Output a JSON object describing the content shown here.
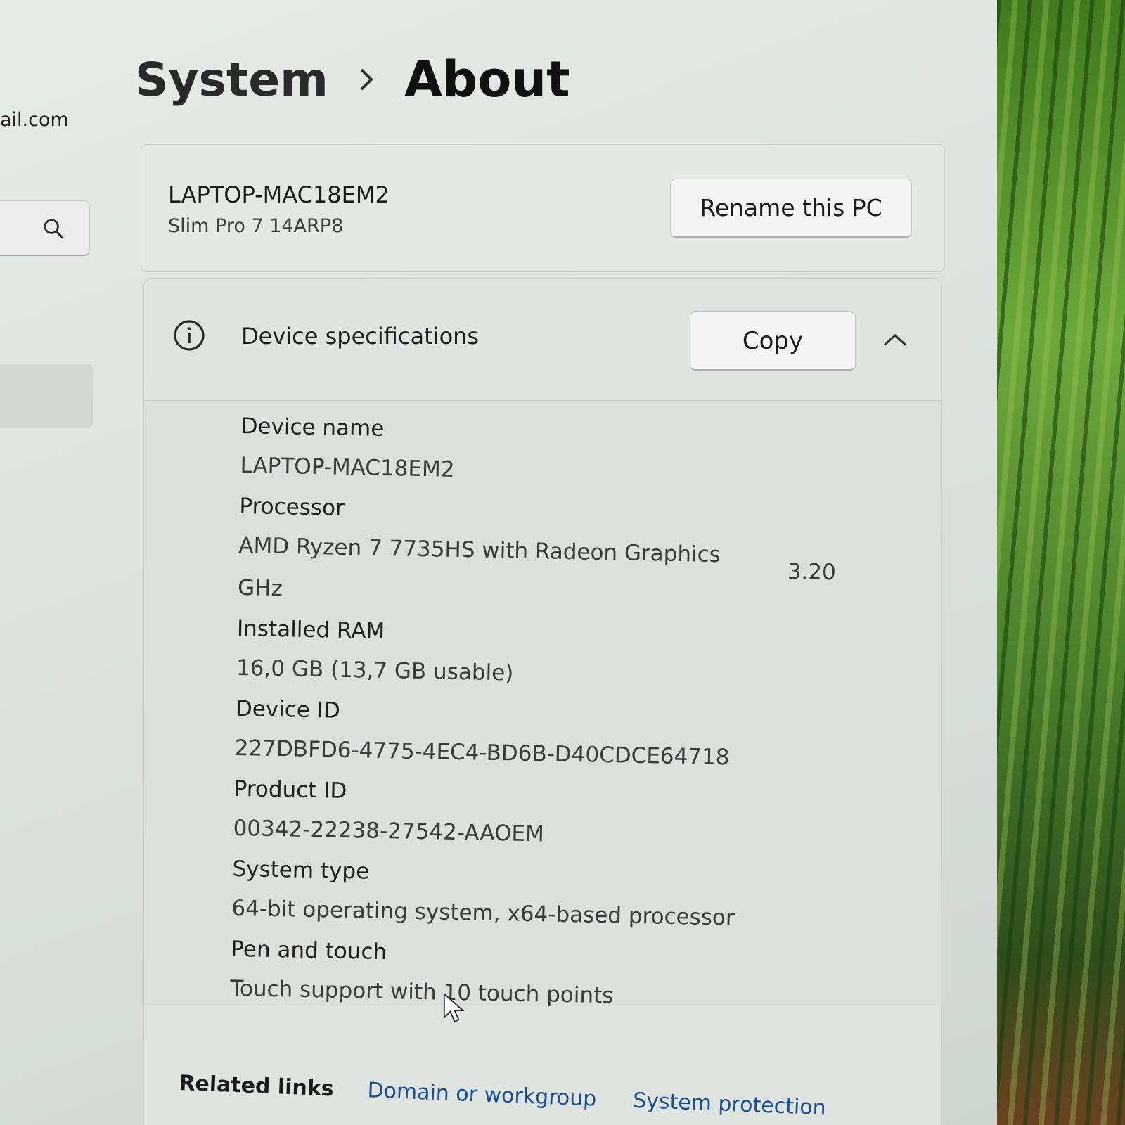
{
  "sidebar": {
    "account_email": "ail.com",
    "search_icon": "search-icon"
  },
  "breadcrumb": {
    "parent": "System",
    "current": "About"
  },
  "pc": {
    "name": "LAPTOP-MAC18EM2",
    "model": "Slim Pro 7 14ARP8",
    "rename_label": "Rename this PC"
  },
  "device_specs": {
    "title": "Device specifications",
    "copy_label": "Copy",
    "icons": [
      "info-icon",
      "chevron-up-icon"
    ],
    "items": [
      {
        "label": "Device name",
        "value": "LAPTOP-MAC18EM2"
      },
      {
        "label": "Processor",
        "value": "AMD Ryzen 7 7735HS with Radeon Graphics",
        "value_extra": "3.20",
        "value_unit": "GHz"
      },
      {
        "label": "Installed RAM",
        "value": "16,0 GB (13,7 GB usable)"
      },
      {
        "label": "Device ID",
        "value": "227DBFD6-4775-4EC4-BD6B-D40CDCE64718"
      },
      {
        "label": "Product ID",
        "value": "00342-22238-27542-AAOEM"
      },
      {
        "label": "System type",
        "value": "64-bit operating system, x64-based processor"
      },
      {
        "label": "Pen and touch",
        "value": "Touch support with 10 touch points"
      }
    ]
  },
  "related_links": {
    "title": "Related links",
    "links": [
      "Domain or workgroup",
      "System protection"
    ]
  },
  "colors": {
    "link": "#1a4e8c",
    "card": "#e4e8e4"
  }
}
